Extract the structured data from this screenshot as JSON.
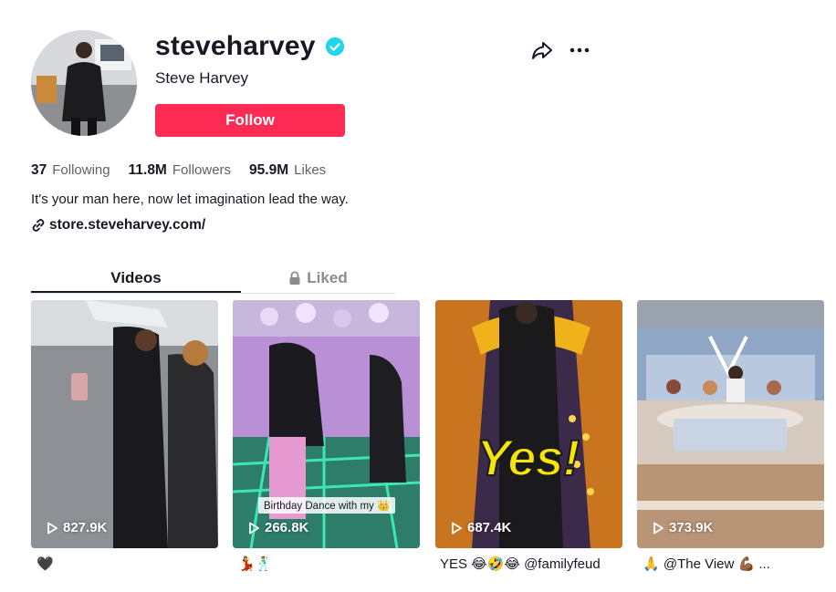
{
  "profile": {
    "username": "steveharvey",
    "nickname": "Steve Harvey",
    "verified": true,
    "follow_label": "Follow",
    "bio": "It's your man here, now let imagination lead the way.",
    "link": "store.steveharvey.com/"
  },
  "stats": {
    "following_count": "37",
    "following_label": "Following",
    "followers_count": "11.8M",
    "followers_label": "Followers",
    "likes_count": "95.9M",
    "likes_label": "Likes"
  },
  "tabs": {
    "videos": "Videos",
    "liked": "Liked"
  },
  "videos": [
    {
      "views": "827.9K",
      "caption": "🖤",
      "overlay": ""
    },
    {
      "views": "266.8K",
      "caption": "💃🕺",
      "overlay": "Birthday Dance with my 👑"
    },
    {
      "views": "687.4K",
      "caption": "YES 😂🤣😂 @familyfeud",
      "overlay": "Yes!"
    },
    {
      "views": "373.9K",
      "caption": "🙏 @The View 💪🏾 ...",
      "overlay": ""
    }
  ],
  "colors": {
    "accent": "#fe2c55",
    "verified": "#20d5ec",
    "text": "#161823",
    "muted": "#5f6068",
    "tab_inactive": "#8a8b91"
  },
  "icons": [
    "verified-icon",
    "share-icon",
    "more-icon",
    "link-icon",
    "lock-icon",
    "play-icon"
  ]
}
